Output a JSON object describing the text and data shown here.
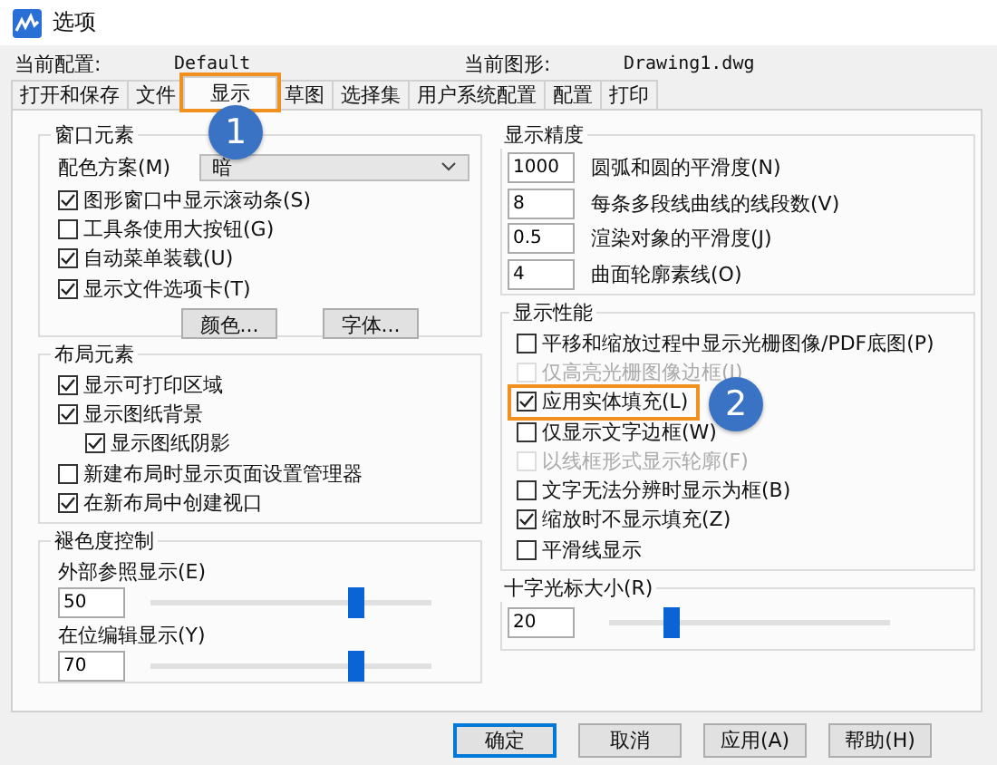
{
  "window": {
    "title": "选项"
  },
  "profile": {
    "label": "当前配置:",
    "value": "Default",
    "drawing_label": "当前图形:",
    "drawing_value": "Drawing1.dwg"
  },
  "tabs": [
    {
      "label": "打开和保存",
      "selected": false
    },
    {
      "label": "文件",
      "selected": false
    },
    {
      "label": "显示",
      "selected": true,
      "callout": "1"
    },
    {
      "label": "草图",
      "selected": false
    },
    {
      "label": "选择集",
      "selected": false
    },
    {
      "label": "用户系统配置",
      "selected": false
    },
    {
      "label": "配置",
      "selected": false
    },
    {
      "label": "打印",
      "selected": false
    }
  ],
  "window_elements": {
    "title": "窗口元素",
    "scheme_label": "配色方案(M)",
    "scheme_value": "暗",
    "options": [
      {
        "label": "图形窗口中显示滚动条(S)",
        "checked": true
      },
      {
        "label": "工具条使用大按钮(G)",
        "checked": false
      },
      {
        "label": "自动菜单装载(U)",
        "checked": true
      },
      {
        "label": "显示文件选项卡(T)",
        "checked": true
      }
    ],
    "buttons": [
      "颜色...",
      "字体..."
    ]
  },
  "layout_elements": {
    "title": "布局元素",
    "options": [
      {
        "label": "显示可打印区域",
        "checked": true
      },
      {
        "label": "显示图纸背景",
        "checked": true,
        "children": [
          {
            "label": "显示图纸阴影",
            "checked": true
          }
        ]
      },
      {
        "label": "新建布局时显示页面设置管理器",
        "checked": false
      },
      {
        "label": "在新布局中创建视口",
        "checked": true
      }
    ]
  },
  "fade_control": {
    "title": "褪色度控制",
    "sliders": [
      {
        "label": "外部参照显示(E)",
        "value": "50",
        "level": 0.75
      },
      {
        "label": "在位编辑显示(Y)",
        "value": "70",
        "level": 0.75
      }
    ]
  },
  "display_resolution": {
    "title": "显示精度",
    "fields": [
      {
        "value": "1000",
        "label": "圆弧和圆的平滑度(N)"
      },
      {
        "value": "8",
        "label": "每条多段线曲线的线段数(V)"
      },
      {
        "value": "0.5",
        "label": "渲染对象的平滑度(J)"
      },
      {
        "value": "4",
        "label": "曲面轮廓素线(O)"
      }
    ]
  },
  "display_performance": {
    "title": "显示性能",
    "options": [
      {
        "label": "平移和缩放过程中显示光栅图像/PDF底图(P)",
        "checked": false,
        "disabled": false
      },
      {
        "label": "仅高亮光栅图像边框(I)",
        "checked": false,
        "disabled": true
      },
      {
        "label": "应用实体填充(L)",
        "checked": true,
        "disabled": false,
        "callout": "2"
      },
      {
        "label": "仅显示文字边框(W)",
        "checked": false,
        "disabled": false
      },
      {
        "label": "以线框形式显示轮廓(F)",
        "checked": false,
        "disabled": true
      },
      {
        "label": "文字无法分辨时显示为框(B)",
        "checked": false,
        "disabled": false
      },
      {
        "label": "缩放时不显示填充(Z)",
        "checked": true,
        "disabled": false
      },
      {
        "label": "平滑线显示",
        "checked": false,
        "disabled": false
      }
    ]
  },
  "crosshair": {
    "title": "十字光标大小(R)",
    "value": "20",
    "level": 0.2
  },
  "buttons": [
    {
      "label": "确定",
      "default": true
    },
    {
      "label": "取消",
      "default": false
    },
    {
      "label": "应用(A)",
      "default": false
    },
    {
      "label": "帮助(H)",
      "default": false
    }
  ]
}
